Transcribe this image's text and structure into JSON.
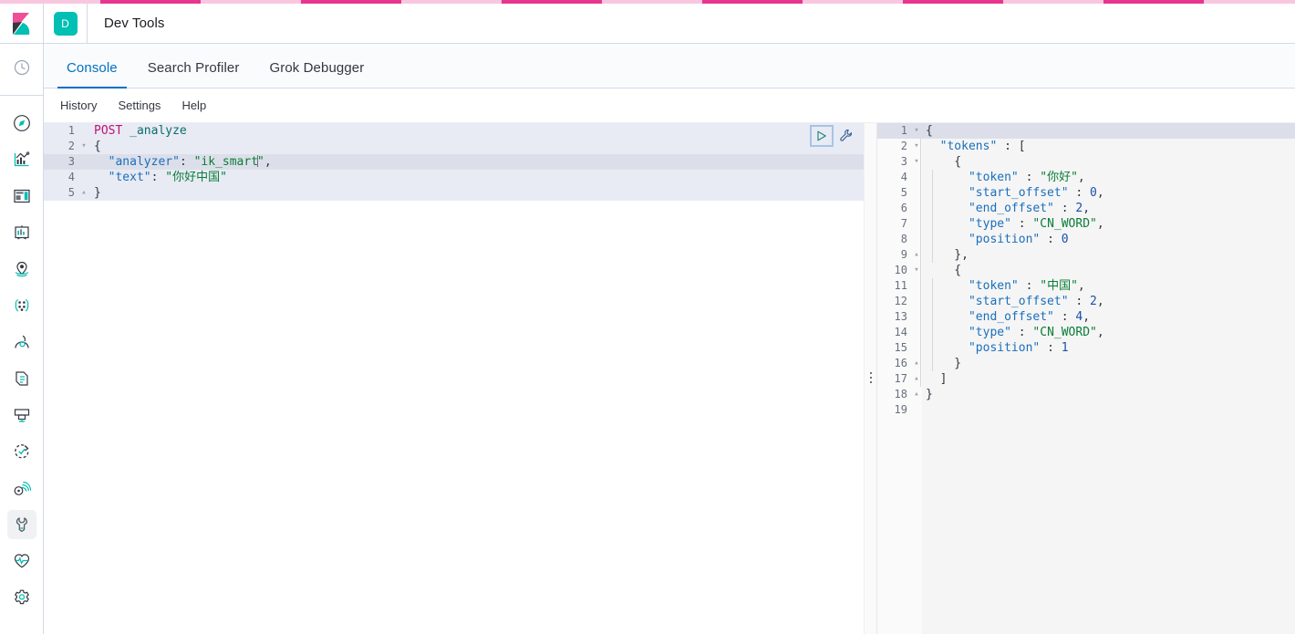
{
  "colors": {
    "brand_pink": "#e8368f",
    "brand_pink_light": "#f8c6df",
    "accent_teal": "#00bfb3",
    "link_blue": "#0071c2",
    "method_magenta": "#c3117a",
    "url_teal": "#0b6c6c",
    "json_key_blue": "#1a6fbb",
    "json_string_green": "#0a7d38",
    "json_number_blue": "#1a4fa8",
    "active_line": "#dcdfe9",
    "request_block": "#e8ebf4",
    "response_bg": "#f5f5f5"
  },
  "header": {
    "logo_icon": "kibana-logo",
    "app_badge": "D",
    "title": "Dev Tools"
  },
  "nav_rail": {
    "items": [
      {
        "icon": "clock-icon",
        "name": "recently-viewed",
        "selected": false
      },
      {
        "icon": "compass-icon",
        "name": "discover",
        "selected": false
      },
      {
        "icon": "bar-chart-icon",
        "name": "visualize",
        "selected": false
      },
      {
        "icon": "dashboard-icon",
        "name": "dashboard",
        "selected": false
      },
      {
        "icon": "canvas-icon",
        "name": "canvas",
        "selected": false
      },
      {
        "icon": "map-marker-icon",
        "name": "maps",
        "selected": false
      },
      {
        "icon": "machine-learning-icon",
        "name": "machine-learning",
        "selected": false
      },
      {
        "icon": "infrastructure-icon",
        "name": "infrastructure",
        "selected": false
      },
      {
        "icon": "logs-icon",
        "name": "logs",
        "selected": false
      },
      {
        "icon": "apm-icon",
        "name": "apm",
        "selected": false
      },
      {
        "icon": "uptime-icon",
        "name": "uptime",
        "selected": false
      },
      {
        "icon": "siem-icon",
        "name": "siem",
        "selected": false
      },
      {
        "icon": "wrench-icon",
        "name": "dev-tools",
        "selected": true
      },
      {
        "icon": "heartbeat-icon",
        "name": "monitoring",
        "selected": false
      },
      {
        "icon": "gear-icon",
        "name": "management",
        "selected": false
      }
    ]
  },
  "tabs": [
    {
      "label": "Console",
      "active": true
    },
    {
      "label": "Search Profiler",
      "active": false
    },
    {
      "label": "Grok Debugger",
      "active": false
    }
  ],
  "console_menu": [
    {
      "label": "History"
    },
    {
      "label": "Settings"
    },
    {
      "label": "Help"
    }
  ],
  "actions": {
    "send_request": "play-icon",
    "wrench_menu": "wrench-icon"
  },
  "splitter": {
    "grip_icon": "grip-dots-icon"
  },
  "request_editor": {
    "active_line": 3,
    "lines": [
      {
        "num": "1",
        "fold": "",
        "tokens": [
          {
            "t": "POST ",
            "c": "tk-method"
          },
          {
            "t": "_analyze",
            "c": "tk-url"
          }
        ]
      },
      {
        "num": "2",
        "fold": "▾",
        "tokens": [
          {
            "t": "{",
            "c": "tk-punc"
          }
        ]
      },
      {
        "num": "3",
        "fold": "",
        "tokens": [
          {
            "t": "  ",
            "c": "tk-punc"
          },
          {
            "t": "\"analyzer\"",
            "c": "tk-key"
          },
          {
            "t": ": ",
            "c": "tk-punc"
          },
          {
            "t": "\"ik_smart",
            "c": "tk-str"
          },
          {
            "t": "CURSOR",
            "c": "cursor"
          },
          {
            "t": "\"",
            "c": "tk-str"
          },
          {
            "t": ",",
            "c": "tk-punc"
          }
        ]
      },
      {
        "num": "4",
        "fold": "",
        "tokens": [
          {
            "t": "  ",
            "c": "tk-punc"
          },
          {
            "t": "\"text\"",
            "c": "tk-key"
          },
          {
            "t": ": ",
            "c": "tk-punc"
          },
          {
            "t": "\"你好中国\"",
            "c": "tk-str"
          }
        ]
      },
      {
        "num": "5",
        "fold": "▴",
        "tokens": [
          {
            "t": "}",
            "c": "tk-punc"
          }
        ]
      }
    ]
  },
  "response_editor": {
    "active_line": 1,
    "lines": [
      {
        "num": "1",
        "fold": "▾",
        "tokens": [
          {
            "t": "{",
            "c": "tk-punc"
          }
        ]
      },
      {
        "num": "2",
        "fold": "▾",
        "tokens": [
          {
            "t": "  ",
            "c": "tk-punc"
          },
          {
            "t": "\"tokens\"",
            "c": "tk-key"
          },
          {
            "t": " : ",
            "c": "tk-punc"
          },
          {
            "t": "[",
            "c": "tk-punc"
          }
        ]
      },
      {
        "num": "3",
        "fold": "▾",
        "tokens": [
          {
            "t": "    {",
            "c": "tk-punc"
          }
        ]
      },
      {
        "num": "4",
        "fold": "",
        "tokens": [
          {
            "t": "      ",
            "c": "tk-punc"
          },
          {
            "t": "\"token\"",
            "c": "tk-key"
          },
          {
            "t": " : ",
            "c": "tk-punc"
          },
          {
            "t": "\"你好\"",
            "c": "tk-str"
          },
          {
            "t": ",",
            "c": "tk-punc"
          }
        ]
      },
      {
        "num": "5",
        "fold": "",
        "tokens": [
          {
            "t": "      ",
            "c": "tk-punc"
          },
          {
            "t": "\"start_offset\"",
            "c": "tk-key"
          },
          {
            "t": " : ",
            "c": "tk-punc"
          },
          {
            "t": "0",
            "c": "tk-num"
          },
          {
            "t": ",",
            "c": "tk-punc"
          }
        ]
      },
      {
        "num": "6",
        "fold": "",
        "tokens": [
          {
            "t": "      ",
            "c": "tk-punc"
          },
          {
            "t": "\"end_offset\"",
            "c": "tk-key"
          },
          {
            "t": " : ",
            "c": "tk-punc"
          },
          {
            "t": "2",
            "c": "tk-num"
          },
          {
            "t": ",",
            "c": "tk-punc"
          }
        ]
      },
      {
        "num": "7",
        "fold": "",
        "tokens": [
          {
            "t": "      ",
            "c": "tk-punc"
          },
          {
            "t": "\"type\"",
            "c": "tk-key"
          },
          {
            "t": " : ",
            "c": "tk-punc"
          },
          {
            "t": "\"CN_WORD\"",
            "c": "tk-str"
          },
          {
            "t": ",",
            "c": "tk-punc"
          }
        ]
      },
      {
        "num": "8",
        "fold": "",
        "tokens": [
          {
            "t": "      ",
            "c": "tk-punc"
          },
          {
            "t": "\"position\"",
            "c": "tk-key"
          },
          {
            "t": " : ",
            "c": "tk-punc"
          },
          {
            "t": "0",
            "c": "tk-num"
          }
        ]
      },
      {
        "num": "9",
        "fold": "▴",
        "tokens": [
          {
            "t": "    },",
            "c": "tk-punc"
          }
        ]
      },
      {
        "num": "10",
        "fold": "▾",
        "tokens": [
          {
            "t": "    {",
            "c": "tk-punc"
          }
        ]
      },
      {
        "num": "11",
        "fold": "",
        "tokens": [
          {
            "t": "      ",
            "c": "tk-punc"
          },
          {
            "t": "\"token\"",
            "c": "tk-key"
          },
          {
            "t": " : ",
            "c": "tk-punc"
          },
          {
            "t": "\"中国\"",
            "c": "tk-str"
          },
          {
            "t": ",",
            "c": "tk-punc"
          }
        ]
      },
      {
        "num": "12",
        "fold": "",
        "tokens": [
          {
            "t": "      ",
            "c": "tk-punc"
          },
          {
            "t": "\"start_offset\"",
            "c": "tk-key"
          },
          {
            "t": " : ",
            "c": "tk-punc"
          },
          {
            "t": "2",
            "c": "tk-num"
          },
          {
            "t": ",",
            "c": "tk-punc"
          }
        ]
      },
      {
        "num": "13",
        "fold": "",
        "tokens": [
          {
            "t": "      ",
            "c": "tk-punc"
          },
          {
            "t": "\"end_offset\"",
            "c": "tk-key"
          },
          {
            "t": " : ",
            "c": "tk-punc"
          },
          {
            "t": "4",
            "c": "tk-num"
          },
          {
            "t": ",",
            "c": "tk-punc"
          }
        ]
      },
      {
        "num": "14",
        "fold": "",
        "tokens": [
          {
            "t": "      ",
            "c": "tk-punc"
          },
          {
            "t": "\"type\"",
            "c": "tk-key"
          },
          {
            "t": " : ",
            "c": "tk-punc"
          },
          {
            "t": "\"CN_WORD\"",
            "c": "tk-str"
          },
          {
            "t": ",",
            "c": "tk-punc"
          }
        ]
      },
      {
        "num": "15",
        "fold": "",
        "tokens": [
          {
            "t": "      ",
            "c": "tk-punc"
          },
          {
            "t": "\"position\"",
            "c": "tk-key"
          },
          {
            "t": " : ",
            "c": "tk-punc"
          },
          {
            "t": "1",
            "c": "tk-num"
          }
        ]
      },
      {
        "num": "16",
        "fold": "▴",
        "tokens": [
          {
            "t": "    }",
            "c": "tk-punc"
          }
        ]
      },
      {
        "num": "17",
        "fold": "▴",
        "tokens": [
          {
            "t": "  ]",
            "c": "tk-punc"
          }
        ]
      },
      {
        "num": "18",
        "fold": "▴",
        "tokens": [
          {
            "t": "}",
            "c": "tk-punc"
          }
        ]
      },
      {
        "num": "19",
        "fold": "",
        "tokens": []
      }
    ]
  }
}
